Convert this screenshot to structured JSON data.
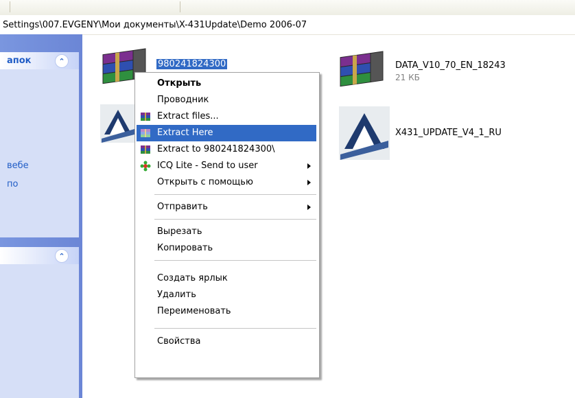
{
  "address": {
    "path": "Settings\\007.EVGENY\\Мои документы\\X-431Update\\Demo 2006-07"
  },
  "task_pane": {
    "section1": {
      "title": "апок",
      "links": [
        "вебе",
        "по"
      ]
    },
    "section2": {
      "title": ""
    },
    "collapse_glyph": "⌃"
  },
  "files": [
    {
      "name": "980241824300",
      "size": "",
      "icon": "winrar-archive-icon",
      "selected": true
    },
    {
      "name": "DATA_V10_70_EN_18243",
      "size": "21 КБ",
      "icon": "winrar-archive-icon",
      "selected": false
    },
    {
      "name": "",
      "size": "",
      "icon": "launch-app-icon",
      "selected": false
    },
    {
      "name": "X431_UPDATE_V4_1_RU",
      "size": "",
      "icon": "launch-app-icon",
      "selected": false
    }
  ],
  "context_menu": {
    "items": [
      {
        "label": "Открыть",
        "bold": true
      },
      {
        "label": "Проводник"
      },
      {
        "label": "Extract files...",
        "icon": "winrar-icon"
      },
      {
        "label": "Extract Here",
        "icon": "winrar-icon",
        "highlighted": true
      },
      {
        "label": "Extract to 980241824300\\",
        "icon": "winrar-icon"
      },
      {
        "label": "ICQ Lite - Send to user",
        "icon": "icq-flower-icon",
        "submenu": true
      },
      {
        "label": "Открыть с помощью",
        "submenu": true
      },
      {
        "label": "Отправить",
        "submenu": true
      },
      {
        "label": "Вырезать"
      },
      {
        "label": "Копировать"
      },
      {
        "label": "Создать ярлык"
      },
      {
        "label": "Удалить"
      },
      {
        "label": "Переименовать"
      },
      {
        "label": "Свойства"
      }
    ]
  },
  "colors": {
    "selection": "#316ac5",
    "task_pane": "#7a96df",
    "link": "#215dc6"
  }
}
